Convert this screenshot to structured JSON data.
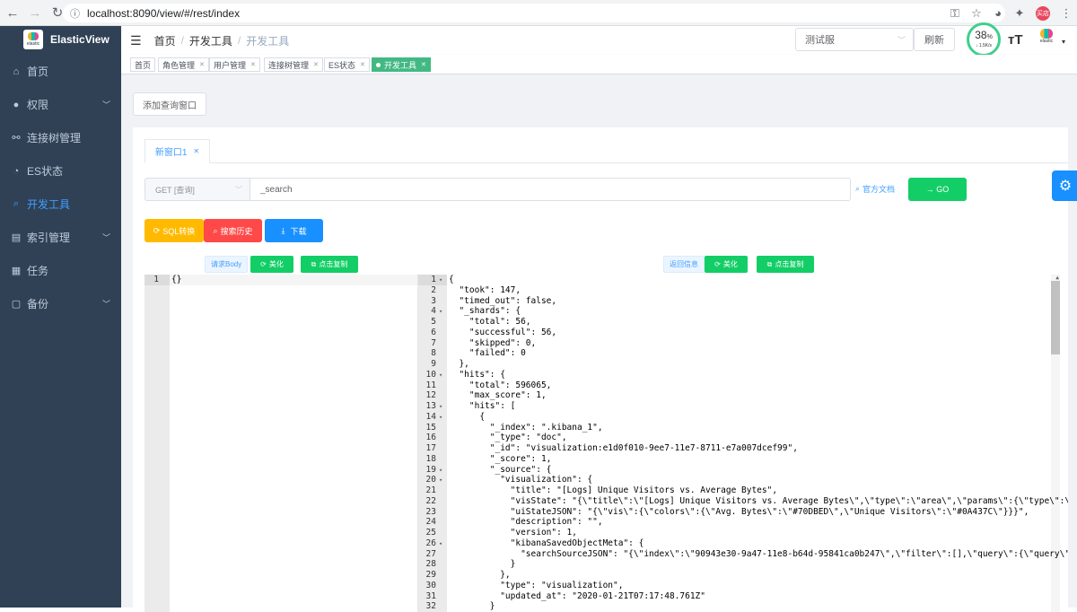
{
  "browser": {
    "url": "localhost:8090/view/#/rest/index",
    "profile": "买店"
  },
  "sidebar": {
    "logo_text": "ElasticView",
    "logo_sub": "elastic",
    "items": [
      {
        "label": "首页",
        "icon": "home-icon",
        "glyph": "⌂",
        "has_arrow": false,
        "active": false
      },
      {
        "label": "权限",
        "icon": "user-icon",
        "glyph": "●",
        "has_arrow": true,
        "active": false
      },
      {
        "label": "连接树管理",
        "icon": "link-icon",
        "glyph": "⚯",
        "has_arrow": false,
        "active": false
      },
      {
        "label": "ES状态",
        "icon": "status-icon",
        "glyph": "◔",
        "has_arrow": false,
        "active": false
      },
      {
        "label": "开发工具",
        "icon": "search-icon",
        "glyph": "⌕",
        "has_arrow": false,
        "active": true
      },
      {
        "label": "索引管理",
        "icon": "database-icon",
        "glyph": "▤",
        "has_arrow": true,
        "active": false
      },
      {
        "label": "任务",
        "icon": "task-icon",
        "glyph": "▦",
        "has_arrow": false,
        "active": false
      },
      {
        "label": "备份",
        "icon": "backup-icon",
        "glyph": "▢",
        "has_arrow": true,
        "active": false
      }
    ]
  },
  "header": {
    "breadcrumb": [
      "首页",
      "开发工具",
      "开发工具"
    ],
    "env_select": "测试服",
    "refresh_label": "刷新",
    "speed_percent": "38",
    "speed_unit": "%",
    "speed_rate": "↓ 1.5K/s",
    "avatar_label": "elastic"
  },
  "tags": [
    {
      "label": "首页",
      "closable": false,
      "active": false
    },
    {
      "label": "角色管理",
      "closable": true,
      "active": false
    },
    {
      "label": "用户管理",
      "closable": true,
      "active": false
    },
    {
      "label": "连接树管理",
      "closable": true,
      "active": false
    },
    {
      "label": "ES状态",
      "closable": true,
      "active": false
    },
    {
      "label": "开发工具",
      "closable": true,
      "active": true
    }
  ],
  "main": {
    "add_query_label": "添加查询窗口",
    "tab_label": "新窗口1",
    "method_label": "GET [查询]",
    "path_value": "_search",
    "doc_link_label": "官方文档",
    "go_label": "→ GO",
    "sql_label": "SQL转换",
    "history_label": "搜索历史",
    "download_label": "下载",
    "request_body_label": "请求Body",
    "beautify_label": "美化",
    "copy_label": "点击复制",
    "response_label": "返回信息"
  },
  "request_editor": {
    "lines": [
      "{}"
    ]
  },
  "response_editor": {
    "lines": [
      "{",
      "  \"took\": 147,",
      "  \"timed_out\": false,",
      "  \"_shards\": {",
      "    \"total\": 56,",
      "    \"successful\": 56,",
      "    \"skipped\": 0,",
      "    \"failed\": 0",
      "  },",
      "  \"hits\": {",
      "    \"total\": 596065,",
      "    \"max_score\": 1,",
      "    \"hits\": [",
      "      {",
      "        \"_index\": \".kibana_1\",",
      "        \"_type\": \"doc\",",
      "        \"_id\": \"visualization:e1d0f010-9ee7-11e7-8711-e7a007dcef99\",",
      "        \"_score\": 1,",
      "        \"_source\": {",
      "          \"visualization\": {",
      "            \"title\": \"[Logs] Unique Visitors vs. Average Bytes\",",
      "            \"visState\": \"{\\\"title\\\":\\\"[Logs] Unique Visitors vs. Average Bytes\\\",\\\"type\\\":\\\"area\\\",\\\"params\\\":{\\\"type\\\":\\\"a",
      "            \"uiStateJSON\": \"{\\\"vis\\\":{\\\"colors\\\":{\\\"Avg. Bytes\\\":\\\"#70DBED\\\",\\\"Unique Visitors\\\":\\\"#0A437C\\\"}}}\",",
      "            \"description\": \"\",",
      "            \"version\": 1,",
      "            \"kibanaSavedObjectMeta\": {",
      "              \"searchSourceJSON\": \"{\\\"index\\\":\\\"90943e30-9a47-11e8-b64d-95841ca0b247\\\",\\\"filter\\\":[],\\\"query\\\":{\\\"query\\\":\\",
      "            }",
      "          },",
      "          \"type\": \"visualization\",",
      "          \"updated_at\": \"2020-01-21T07:17:48.761Z\"",
      "        }"
    ],
    "fold_lines": [
      1,
      4,
      10,
      13,
      14,
      19,
      20,
      26
    ]
  }
}
